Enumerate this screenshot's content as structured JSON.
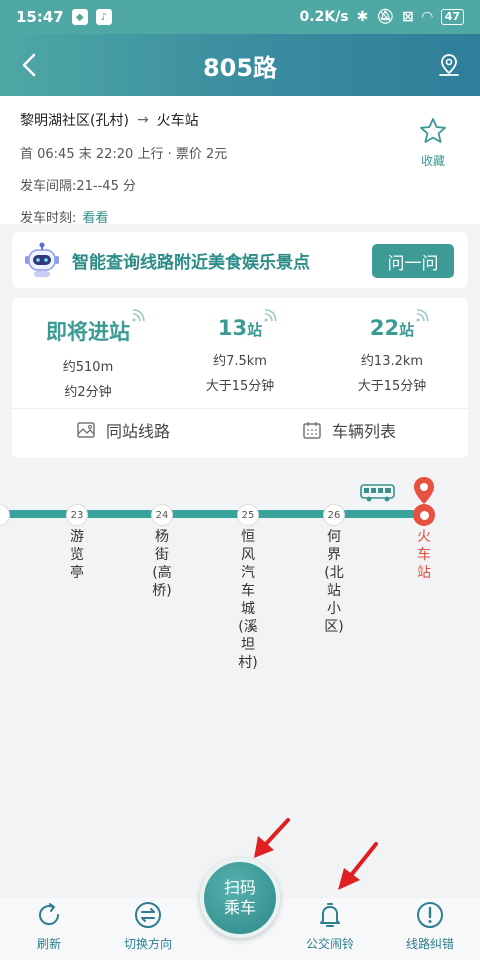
{
  "status": {
    "time": "15:47",
    "network_speed": "0.2K/s",
    "battery": "47"
  },
  "header": {
    "title": "805路"
  },
  "info": {
    "origin": "黎明湖社区(孔村)",
    "destination": "火车站",
    "schedule": "首 06:45 末 22:20 上行 · 票价 2元",
    "interval": "发车间隔:21--45 分",
    "timetable_label": "发车时刻:",
    "timetable_link": "看看",
    "favorite_label": "收藏"
  },
  "ai": {
    "text": "智能查询线路附近美食娱乐景点",
    "button": "问一问"
  },
  "arrivals": [
    {
      "main": "即将进站",
      "unit": "",
      "distance": "约510m",
      "time": "约2分钟"
    },
    {
      "main": "13",
      "unit": "站",
      "distance": "约7.5km",
      "time": "大于15分钟"
    },
    {
      "main": "22",
      "unit": "站",
      "distance": "约13.2km",
      "time": "大于15分钟"
    }
  ],
  "sub_buttons": {
    "same_station": "同站线路",
    "vehicle_list": "车辆列表"
  },
  "stations": [
    {
      "num": "23",
      "name": "游览亭"
    },
    {
      "num": "24",
      "name": "杨街(高桥)"
    },
    {
      "num": "25",
      "name": "恒风汽车城(溪坦村)"
    },
    {
      "num": "26",
      "name": "何界(北站小区)"
    },
    {
      "num": "",
      "name": "火车站"
    }
  ],
  "bottom": {
    "refresh": "刷新",
    "switch": "切换方向",
    "scan_line1": "扫码",
    "scan_line2": "乘车",
    "alarm": "公交闹铃",
    "report": "线路纠错"
  },
  "colors": {
    "accent": "#3a9a94",
    "destination": "#e05040",
    "arrow": "#e02020"
  }
}
